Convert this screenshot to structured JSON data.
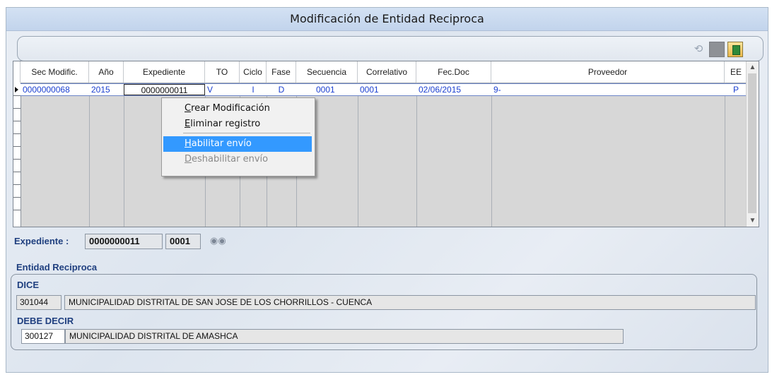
{
  "window": {
    "title": "Modificación de Entidad Reciproca"
  },
  "toolbar": {
    "buttons": [
      {
        "name": "undo",
        "icon": "undo-icon",
        "glyph": "⟲"
      },
      {
        "name": "gray-square",
        "icon": "square-icon"
      },
      {
        "name": "exit",
        "icon": "exit-door-icon"
      }
    ]
  },
  "grid": {
    "columns": [
      "Sec Modific.",
      "Año",
      "Expediente",
      "TO",
      "Ciclo",
      "Fase",
      "Secuencia",
      "Correlativo",
      "Fec.Doc",
      "Proveedor",
      "EE"
    ],
    "rows": [
      {
        "sec_modific": "0000000068",
        "anio": "2015",
        "expediente": "0000000011",
        "to": "V",
        "ciclo": "I",
        "fase": "D",
        "secuencia": "0001",
        "correlativo": "0001",
        "fec_doc": "02/06/2015",
        "proveedor": "9-",
        "ee": "P"
      }
    ]
  },
  "context_menu": {
    "items": [
      {
        "label": "Crear Modificación",
        "accel": "C",
        "rest": "rear Modificación",
        "state": "normal"
      },
      {
        "label": "Eliminar registro",
        "accel": "E",
        "rest": "liminar registro",
        "state": "normal"
      },
      {
        "label": "Habilitar envío",
        "accel": "H",
        "rest": "abilitar envío",
        "state": "highlighted"
      },
      {
        "label": "Deshabilitar envío",
        "accel": "D",
        "rest": "eshabilitar envío",
        "state": "disabled"
      }
    ]
  },
  "expediente": {
    "label": "Expediente :",
    "number": "0000000011",
    "secuencia": "0001"
  },
  "entidad": {
    "title": "Entidad Reciproca",
    "dice": {
      "label": "DICE",
      "code": "301044",
      "name": "MUNICIPALIDAD DISTRITAL DE SAN JOSE DE LOS CHORRILLOS - CUENCA"
    },
    "debe_decir": {
      "label": "DEBE DECIR",
      "code": "300127",
      "name": "MUNICIPALIDAD DISTRITAL DE AMASHCA"
    }
  },
  "colors": {
    "selection": "#3399ff",
    "data_text": "#1a3fd0",
    "label_text": "#1f3f7f"
  }
}
